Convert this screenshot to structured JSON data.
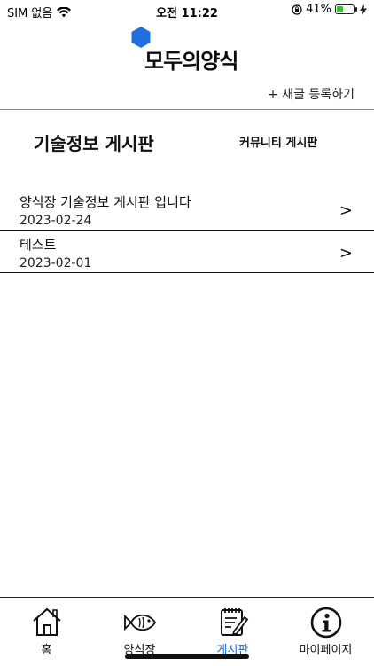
{
  "status_bar": {
    "carrier": "SIM 없음",
    "time": "오전 11:22",
    "battery_percent": "41%",
    "battery_level": 0.41,
    "icons": [
      "wifi-icon",
      "orientation-lock-icon",
      "battery-icon",
      "charging-icon"
    ]
  },
  "header": {
    "logo_text": "모두의양식",
    "logo_color": "#1f6fe0",
    "new_post_label": "+ 새글 등록하기"
  },
  "tabs": {
    "active": "기술정보 게시판",
    "other": "커뮤니티 게시판"
  },
  "posts": [
    {
      "title": "양식장 기술정보 게시판 입니다",
      "date": "2023-02-24",
      "chevron": ">"
    },
    {
      "title": "테스트",
      "date": "2023-02-01",
      "chevron": ">"
    }
  ],
  "bottom_nav": {
    "items": [
      {
        "label": "홈",
        "icon": "home-icon"
      },
      {
        "label": "양식장",
        "icon": "fish-icon"
      },
      {
        "label": "게시판",
        "icon": "notepad-icon"
      },
      {
        "label": "마이페이지",
        "icon": "info-icon"
      }
    ],
    "active_index": 2,
    "active_color": "#1f6bd6"
  }
}
